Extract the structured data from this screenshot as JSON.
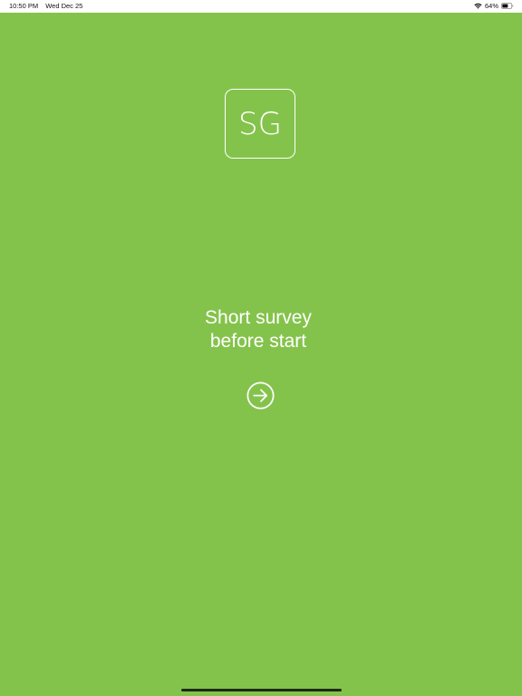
{
  "status_bar": {
    "time": "10:50 PM",
    "date": "Wed Dec 25",
    "battery_percent": "64%",
    "battery_level": 0.64,
    "icons": [
      "wifi-icon",
      "battery-icon"
    ]
  },
  "logo": {
    "text": "SG"
  },
  "intro": {
    "line1": "Short survey",
    "line2": "before start"
  },
  "next_button": {
    "icon": "arrow-right-circle-icon"
  },
  "colors": {
    "background": "#84c34b",
    "foreground": "#ffffff",
    "status_bar": "#ffffff"
  }
}
